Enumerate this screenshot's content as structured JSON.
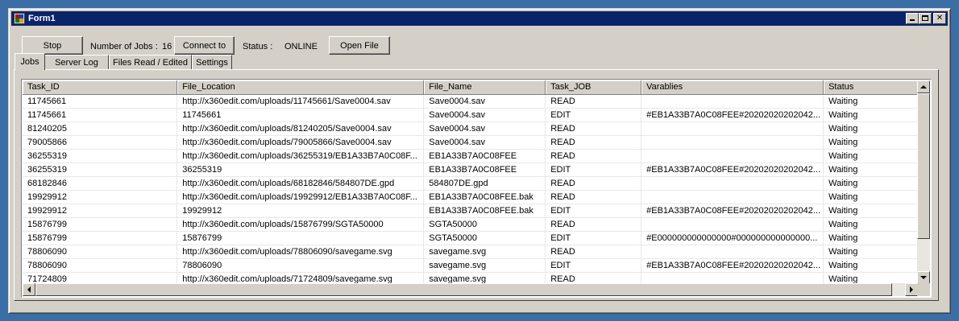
{
  "window": {
    "title": "Form1",
    "icon": "app-icon",
    "controls": [
      "minimize-icon",
      "maximize-icon",
      "close-icon"
    ],
    "close_glyph": "✕"
  },
  "toolbar": {
    "stop_label": "Stop",
    "jobs_label": "Number of Jobs :",
    "jobs_count": "16",
    "connect_label": "Connect to",
    "status_label": "Status :",
    "status_value": "ONLINE",
    "open_file_label": "Open File"
  },
  "tabs": [
    {
      "label": "Jobs",
      "active": true
    },
    {
      "label": "Server Log",
      "active": false
    },
    {
      "label": "Files Read / Edited",
      "active": false
    },
    {
      "label": "Settings",
      "active": false
    }
  ],
  "grid": {
    "columns": [
      "Task_ID",
      "File_Location",
      "File_Name",
      "Task_JOB",
      "Varablies",
      "Status"
    ],
    "rows": [
      [
        "11745661",
        "http://x360edit.com/uploads/11745661/Save0004.sav",
        "Save0004.sav",
        "READ",
        "",
        "Waiting"
      ],
      [
        "11745661",
        "11745661",
        "Save0004.sav",
        "EDIT",
        "#EB1A33B7A0C08FEE#20202020202042...",
        "Waiting"
      ],
      [
        "81240205",
        "http://x360edit.com/uploads/81240205/Save0004.sav",
        "Save0004.sav",
        "READ",
        "",
        "Waiting"
      ],
      [
        "79005866",
        "http://x360edit.com/uploads/79005866/Save0004.sav",
        "Save0004.sav",
        "READ",
        "",
        "Waiting"
      ],
      [
        "36255319",
        "http://x360edit.com/uploads/36255319/EB1A33B7A0C08F...",
        "EB1A33B7A0C08FEE",
        "READ",
        "",
        "Waiting"
      ],
      [
        "36255319",
        "36255319",
        "EB1A33B7A0C08FEE",
        "EDIT",
        "#EB1A33B7A0C08FEE#20202020202042...",
        "Waiting"
      ],
      [
        "68182846",
        "http://x360edit.com/uploads/68182846/584807DE.gpd",
        "584807DE.gpd",
        "READ",
        "",
        "Waiting"
      ],
      [
        "19929912",
        "http://x360edit.com/uploads/19929912/EB1A33B7A0C08F...",
        "EB1A33B7A0C08FEE.bak",
        "READ",
        "",
        "Waiting"
      ],
      [
        "19929912",
        "19929912",
        "EB1A33B7A0C08FEE.bak",
        "EDIT",
        "#EB1A33B7A0C08FEE#20202020202042...",
        "Waiting"
      ],
      [
        "15876799",
        "http://x360edit.com/uploads/15876799/SGTA50000",
        "SGTA50000",
        "READ",
        "",
        "Waiting"
      ],
      [
        "15876799",
        "15876799",
        "SGTA50000",
        "EDIT",
        "#E000000000000000#000000000000000...",
        "Waiting"
      ],
      [
        "78806090",
        "http://x360edit.com/uploads/78806090/savegame.svg",
        "savegame.svg",
        "READ",
        "",
        "Waiting"
      ],
      [
        "78806090",
        "78806090",
        "savegame.svg",
        "EDIT",
        "#EB1A33B7A0C08FEE#20202020202042...",
        "Waiting"
      ],
      [
        "71724809",
        "http://x360edit.com/uploads/71724809/savegame.svg",
        "savegame.svg",
        "READ",
        "",
        "Waiting"
      ]
    ]
  }
}
